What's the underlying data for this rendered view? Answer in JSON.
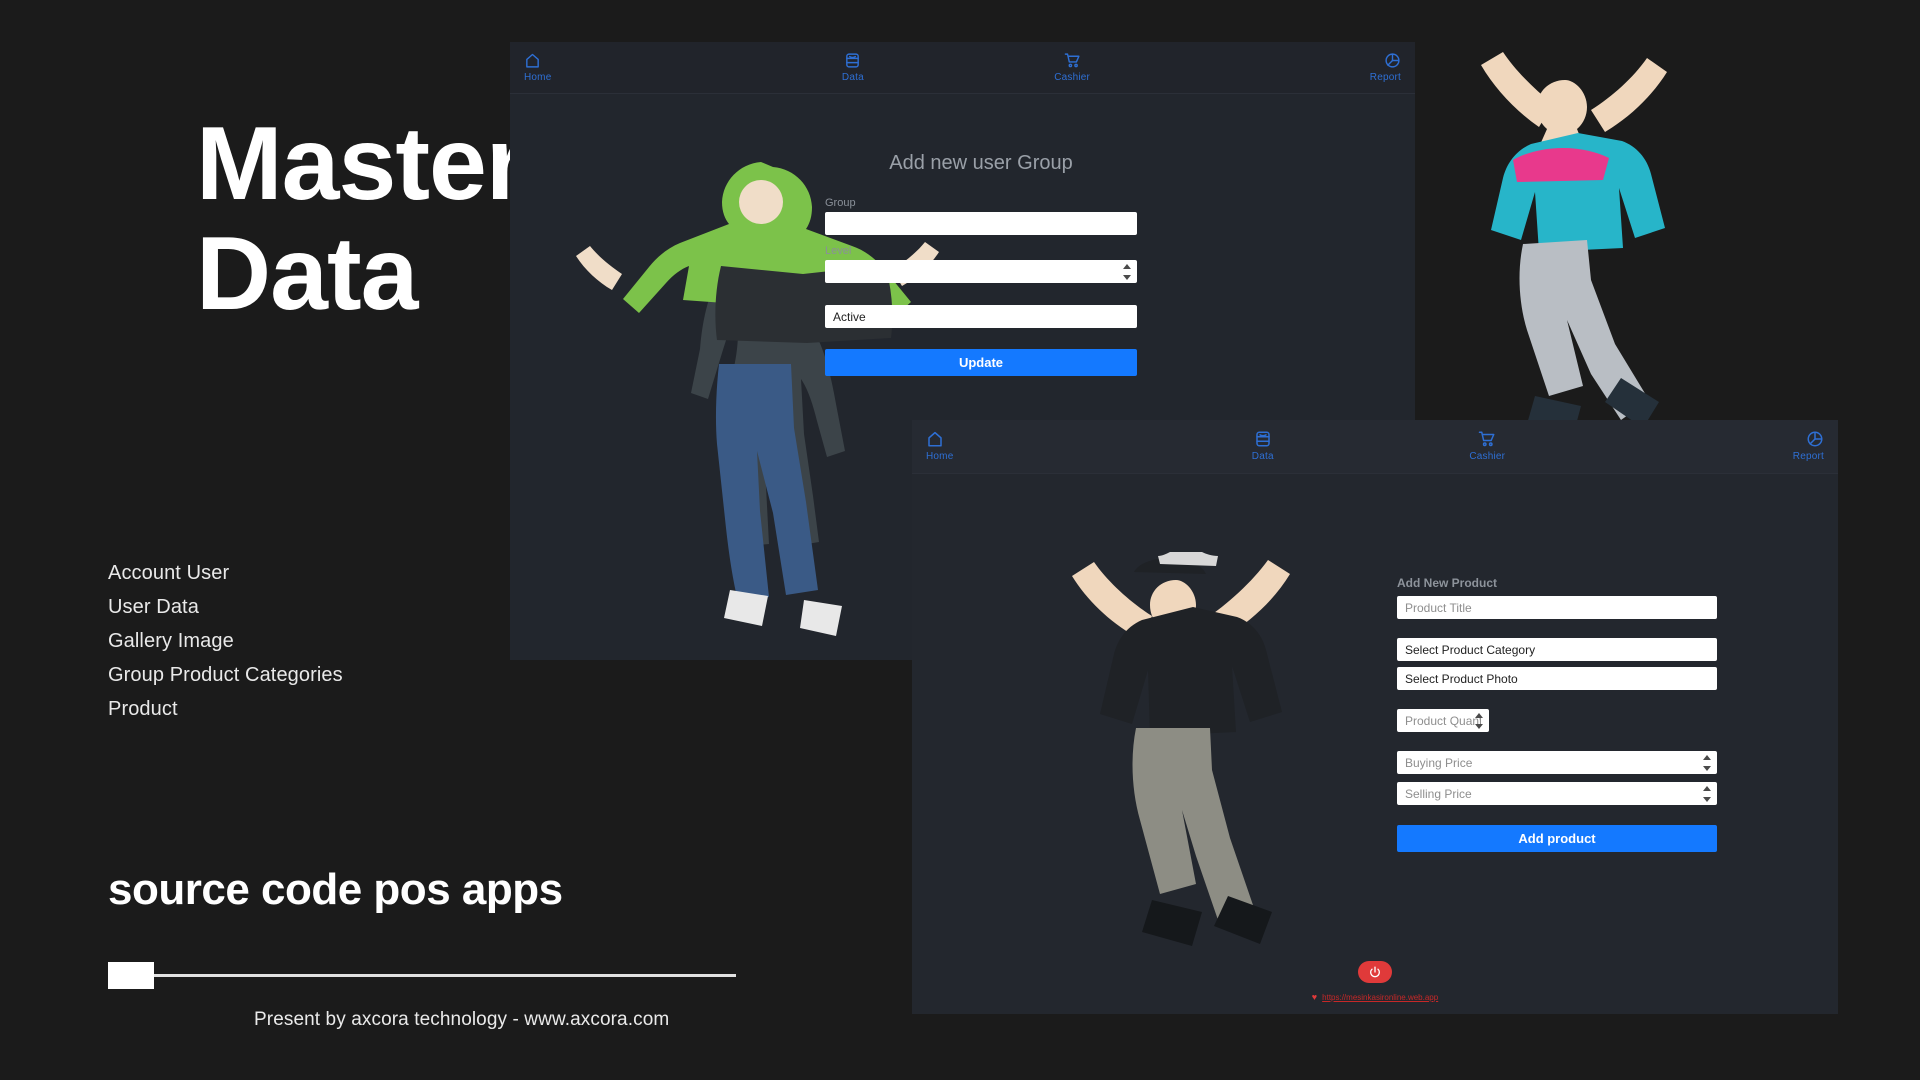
{
  "promo": {
    "title_line1": "Master",
    "title_line2": "Data",
    "features": [
      "Account User",
      "User Data",
      "Gallery Image",
      "Group Product Categories",
      "Product"
    ],
    "subtitle": "source code pos apps",
    "presented_by": "Present by axcora technology - www.axcora.com"
  },
  "colors": {
    "background": "#1b1b1b",
    "window_bg": "#22262d",
    "nav_accent": "#2e6fd4",
    "primary_button": "#1479ff",
    "danger": "#e03a3a",
    "link": "#c62828"
  },
  "nav": {
    "items": [
      {
        "label": "Home",
        "icon": "home-icon"
      },
      {
        "label": "Data",
        "icon": "database-icon"
      },
      {
        "label": "Cashier",
        "icon": "shopping-cart-icon"
      },
      {
        "label": "Report",
        "icon": "pie-chart-icon"
      }
    ]
  },
  "user_group_window": {
    "form_title": "Add new user Group",
    "group_label": "Group",
    "group_value": "",
    "group_placeholder": "",
    "level_label": "Level",
    "level_value": "",
    "level_placeholder": "",
    "status_value": "Active",
    "submit_label": "Update"
  },
  "product_window": {
    "form_title": "Add New Product",
    "fields": [
      {
        "name": "product-title",
        "placeholder": "Product Title",
        "value": "",
        "spinner": false
      },
      {
        "name": "product-category",
        "placeholder": "Select Product Category",
        "value": "Select Product Category",
        "spinner": false
      },
      {
        "name": "product-photo",
        "placeholder": "Select Product Photo",
        "value": "Select Product Photo",
        "spinner": false
      },
      {
        "name": "product-quantity",
        "placeholder": "Product Quantity",
        "value": "",
        "spinner": true
      },
      {
        "name": "buying-price",
        "placeholder": "Buying Price",
        "value": "",
        "spinner": true
      },
      {
        "name": "selling-price",
        "placeholder": "Selling Price",
        "value": "",
        "spinner": true
      }
    ],
    "submit_label": "Add product",
    "footer_link": "https://mesinkasironline.web.app",
    "power_icon": "power-icon",
    "heart_icon": "heart-icon"
  }
}
